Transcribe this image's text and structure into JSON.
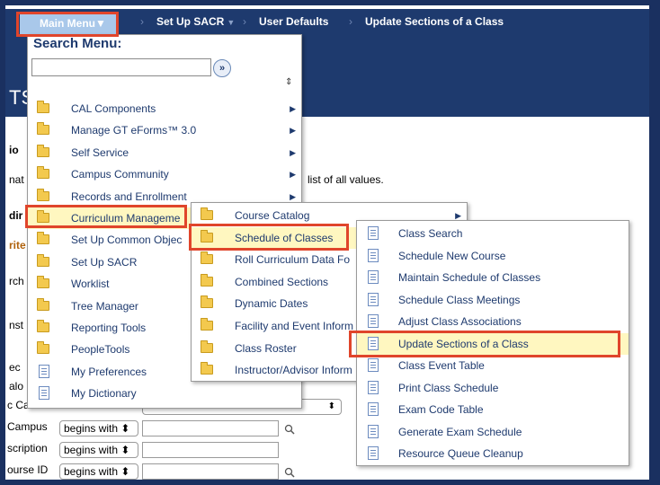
{
  "breadcrumbs": {
    "main_menu": "Main Menu",
    "setup_sacr": "Set Up SACR",
    "user_defaults": "User Defaults",
    "update_sections": "Update Sections of a Class"
  },
  "background": {
    "page_title_fragment": "TS",
    "frag_io": "io",
    "frag_nat": "nat",
    "list_hint": "list of all values.",
    "frag_dir": "dir",
    "frag_rite": "rite",
    "frag_rch": "rch",
    "frag_nst": "nst",
    "frag_ec": "ec",
    "frag_alo": "alo",
    "career_label": "c Career",
    "campus_label": "Campus",
    "description_label": "scription",
    "course_id_label": "ourse ID",
    "op_begins_with": "begins with"
  },
  "search": {
    "label": "Search Menu:",
    "value": "",
    "go_symbol": "»",
    "sort_symbol": "⇕"
  },
  "main_menu_items": [
    {
      "label": "CAL Components",
      "icon": "folder-icon",
      "submenu": true
    },
    {
      "label": "Manage GT eForms™ 3.0",
      "icon": "folder-icon",
      "submenu": true
    },
    {
      "label": "Self Service",
      "icon": "folder-icon",
      "submenu": true
    },
    {
      "label": "Campus Community",
      "icon": "folder-icon",
      "submenu": true
    },
    {
      "label": "Records and Enrollment",
      "icon": "folder-icon",
      "submenu": true
    },
    {
      "label": "Curriculum Manageme",
      "icon": "folder-icon",
      "submenu": false
    },
    {
      "label": "Set Up Common Objec",
      "icon": "folder-icon",
      "submenu": false
    },
    {
      "label": "Set Up SACR",
      "icon": "folder-icon",
      "submenu": false
    },
    {
      "label": "Worklist",
      "icon": "folder-icon",
      "submenu": false
    },
    {
      "label": "Tree Manager",
      "icon": "folder-icon",
      "submenu": false
    },
    {
      "label": "Reporting Tools",
      "icon": "folder-icon",
      "submenu": false
    },
    {
      "label": "PeopleTools",
      "icon": "folder-icon",
      "submenu": false
    },
    {
      "label": "My Preferences",
      "icon": "document-icon",
      "submenu": false
    },
    {
      "label": "My Dictionary",
      "icon": "document-icon",
      "submenu": false
    }
  ],
  "curriculum_menu_items": [
    {
      "label": "Course Catalog",
      "icon": "folder-icon",
      "submenu": true
    },
    {
      "label": "Schedule of Classes",
      "icon": "folder-icon",
      "submenu": false
    },
    {
      "label": "Roll Curriculum Data Fo",
      "icon": "folder-icon",
      "submenu": false
    },
    {
      "label": "Combined Sections",
      "icon": "folder-icon",
      "submenu": false
    },
    {
      "label": "Dynamic Dates",
      "icon": "folder-icon",
      "submenu": false
    },
    {
      "label": "Facility and Event Inform",
      "icon": "folder-icon",
      "submenu": false
    },
    {
      "label": "Class Roster",
      "icon": "folder-icon",
      "submenu": false
    },
    {
      "label": "Instructor/Advisor Inform",
      "icon": "folder-icon",
      "submenu": false
    }
  ],
  "schedule_menu_items": [
    {
      "label": "Class Search",
      "icon": "document-icon"
    },
    {
      "label": "Schedule New Course",
      "icon": "document-icon"
    },
    {
      "label": "Maintain Schedule of Classes",
      "icon": "document-icon"
    },
    {
      "label": "Schedule Class Meetings",
      "icon": "document-icon"
    },
    {
      "label": "Adjust Class Associations",
      "icon": "document-icon"
    },
    {
      "label": "Update Sections of a Class",
      "icon": "document-icon"
    },
    {
      "label": "Class Event Table",
      "icon": "document-icon"
    },
    {
      "label": "Print Class Schedule",
      "icon": "document-icon"
    },
    {
      "label": "Exam Code Table",
      "icon": "document-icon"
    },
    {
      "label": "Generate Exam Schedule",
      "icon": "document-icon"
    },
    {
      "label": "Resource Queue Cleanup",
      "icon": "document-icon"
    }
  ],
  "colors": {
    "nav_bar": "#1e3a6e",
    "highlight": "#fff7c0",
    "callout_red": "#e0452b",
    "folder": "#f3c94e"
  }
}
